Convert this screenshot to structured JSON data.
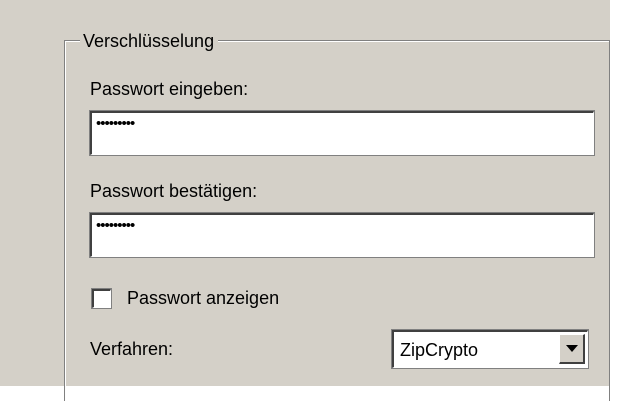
{
  "group": {
    "title": "Verschlüsselung"
  },
  "password": {
    "label": "Passwort eingeben:",
    "value": "•••••••••"
  },
  "confirm": {
    "label": "Passwort bestätigen:",
    "value": "•••••••••"
  },
  "show_password": {
    "label": "Passwort anzeigen",
    "checked": false
  },
  "method": {
    "label": "Verfahren:",
    "value": "ZipCrypto"
  },
  "icons": {
    "dropdown": "chevron-down-icon"
  },
  "colors": {
    "panel": "#d4d0c8",
    "border_dark": "#404040",
    "border_mid": "#808080",
    "field": "#ffffff"
  }
}
